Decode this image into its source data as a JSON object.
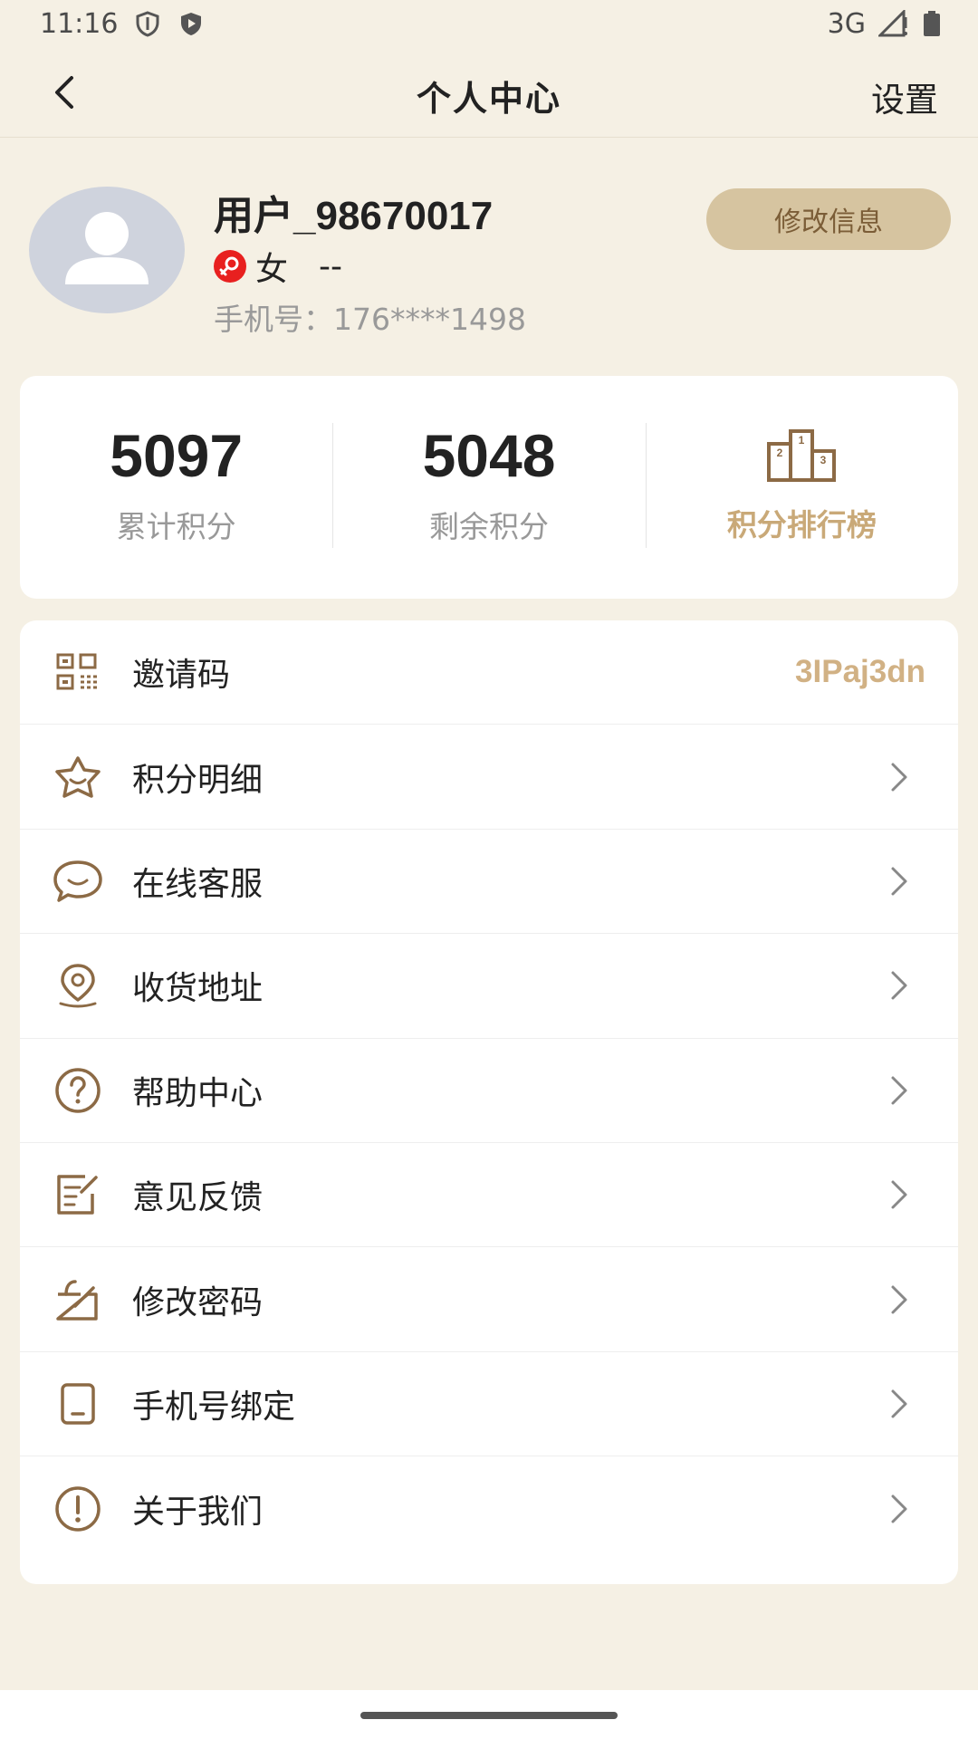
{
  "status_bar": {
    "time": "11:16",
    "network": "3G",
    "icons": [
      "shield-icon",
      "play-shield-icon",
      "signal-icon",
      "battery-icon"
    ]
  },
  "header": {
    "title": "个人中心",
    "settings_label": "设置",
    "back_icon": "chevron-left-icon"
  },
  "profile": {
    "username": "用户_98670017",
    "gender": "女",
    "age": "--",
    "phone": "手机号：176****1498",
    "edit_button": "修改信息"
  },
  "points": {
    "total_value": "5097",
    "total_label": "累计积分",
    "remaining_value": "5048",
    "remaining_label": "剩余积分",
    "ranking_label": "积分排行榜"
  },
  "menu": {
    "items": [
      {
        "label": "邀请码",
        "value": "3IPaj3dn",
        "icon": "qr-code-icon"
      },
      {
        "label": "积分明细",
        "icon": "star-icon"
      },
      {
        "label": "在线客服",
        "icon": "chat-icon"
      },
      {
        "label": "收货地址",
        "icon": "location-icon"
      },
      {
        "label": "帮助中心",
        "icon": "help-icon"
      },
      {
        "label": "意见反馈",
        "icon": "feedback-icon"
      },
      {
        "label": "修改密码",
        "icon": "lock-edit-icon"
      },
      {
        "label": "手机号绑定",
        "icon": "phone-icon"
      },
      {
        "label": "关于我们",
        "icon": "info-icon"
      }
    ]
  },
  "colors": {
    "background": "#f5f0e4",
    "accent_gold": "#c9a978",
    "icon_brown": "#8c6a45",
    "button_bg": "#d6c4a0",
    "gender_red": "#e8201f"
  }
}
